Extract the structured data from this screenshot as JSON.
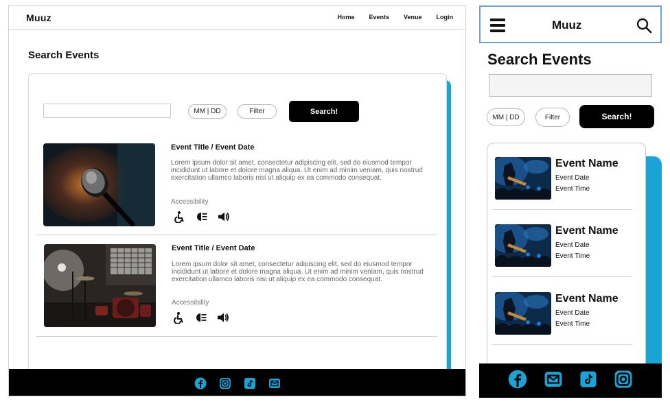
{
  "brand": "Muuz",
  "accent_color": "#1aa4d6",
  "desktop": {
    "nav": {
      "home": "Home",
      "events": "Events",
      "venue": "Venue",
      "login": "Login"
    },
    "page_title": "Search Events",
    "search": {
      "placeholder": "",
      "date": "MM | DD",
      "filter": "Filter",
      "button": "Search!"
    },
    "events": [
      {
        "title": "Event Title / Event Date",
        "description": "Lorem ipsum dolor sit amet, consectetur adipiscing elit, sed do eiusmod tempor incididunt ut labore et dolore magna aliqua. Ut enim ad minim veniam, quis nostrud exercitation ullamco laboris nisi ut aliquip ex ea commodo consequat.",
        "accessibility_label": "Accessibility",
        "image": "microphone-photo",
        "icons": [
          "wheelchair-icon",
          "audio-description-icon",
          "speaker-icon"
        ]
      },
      {
        "title": "Event Title / Event Date",
        "description": "Lorem ipsum dolor sit amet, consectetur adipiscing elit, sed do eiusmod tempor incididunt ut labore et dolore magna aliqua. Ut enim ad minim veniam, quis nostrud exercitation ullamco laboris nisi ut aliquip ex ea commodo consequat.",
        "accessibility_label": "Accessibility",
        "image": "stage-drums-photo",
        "icons": [
          "wheelchair-icon",
          "audio-description-icon",
          "speaker-icon"
        ]
      }
    ],
    "footer_icons": [
      "facebook-icon",
      "instagram-icon",
      "tiktok-icon",
      "mail-icon"
    ]
  },
  "mobile": {
    "page_title": "Search Events",
    "search": {
      "placeholder": "",
      "date": "MM | DD",
      "filter": "Filter",
      "button": "Search!"
    },
    "items": [
      {
        "name": "Event Name",
        "date": "Event Date",
        "time": "Event Time",
        "image": "concert-crowd-photo"
      },
      {
        "name": "Event Name",
        "date": "Event Date",
        "time": "Event Time",
        "image": "concert-crowd-photo"
      },
      {
        "name": "Event Name",
        "date": "Event Date",
        "time": "Event Time",
        "image": "concert-crowd-photo"
      }
    ],
    "footer_icons": [
      "facebook-icon",
      "mail-icon",
      "tiktok-icon",
      "instagram-icon"
    ]
  }
}
